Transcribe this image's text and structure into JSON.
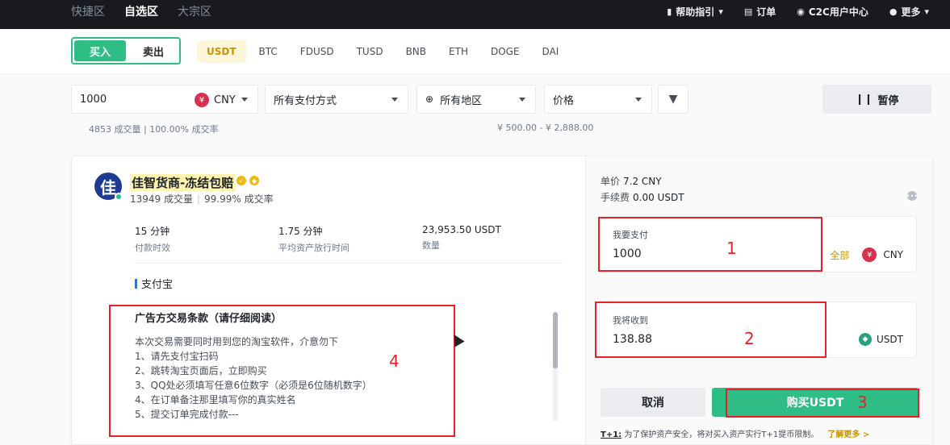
{
  "topnav": {
    "tabs": [
      "快捷区",
      "自选区",
      "大宗区"
    ],
    "active_tab": "自选区",
    "help": "帮助指引",
    "orders": "订单",
    "c2c": "C2C用户中心",
    "more": "更多"
  },
  "trade": {
    "buy": "买入",
    "sell": "卖出",
    "coins": [
      "USDT",
      "BTC",
      "FDUSD",
      "TUSD",
      "BNB",
      "ETH",
      "DOGE",
      "DAI"
    ],
    "active_coin": "USDT"
  },
  "filters": {
    "amount": "1000",
    "fiat": "CNY",
    "payment": "所有支付方式",
    "region": "所有地区",
    "sort": "价格",
    "pause": "暂停"
  },
  "prev_row": {
    "stats": "4853 成交量  |  100.00% 成交率",
    "range": "¥ 500.00 - ¥ 2,888.00"
  },
  "merchant": {
    "avatar_char": "佳",
    "name": "佳智货商-冻结包赔",
    "orders": "13949 成交量",
    "rate": "99.99% 成交率",
    "metrics": [
      {
        "value": "15 分钟",
        "label": "付款时效"
      },
      {
        "value": "1.75 分钟",
        "label": "平均资产放行时间"
      },
      {
        "value": "23,953.50 USDT",
        "label": "数量"
      }
    ],
    "payment_method": "支付宝",
    "terms_title": "广告方交易条款（请仔细阅读）",
    "terms_lines": [
      "本次交易需要同时用到您的淘宝软件，介意勿下",
      "1、请先支付宝扫码",
      "2、跳转淘宝页面后，立即购买",
      "3、QQ处必须填写任意6位数字（必须是6位随机数字）",
      "4、在订单备注那里填写你的真实姓名",
      "5、提交订单完成付款---"
    ]
  },
  "order": {
    "price_label": "单价",
    "price_value": "7.2 CNY",
    "fee_label": "手续费",
    "fee_value": "0.00 USDT",
    "pay_label": "我要支付",
    "pay_value": "1000",
    "pay_all": "全部",
    "pay_unit": "CNY",
    "receive_label": "我将收到",
    "receive_value": "138.88",
    "receive_unit": "USDT",
    "cancel": "取消",
    "buy": "购买USDT",
    "note_tag": "T+1:",
    "note_text": "为了保护资产安全，将对买入资产实行T+1提币限制。",
    "note_link": "了解更多 >"
  },
  "annotations": [
    "1",
    "2",
    "3",
    "4"
  ],
  "colors": {
    "accent_green": "#2ebd85",
    "annotation_red": "#e8202a",
    "brand_yellow": "#f0b90b"
  }
}
